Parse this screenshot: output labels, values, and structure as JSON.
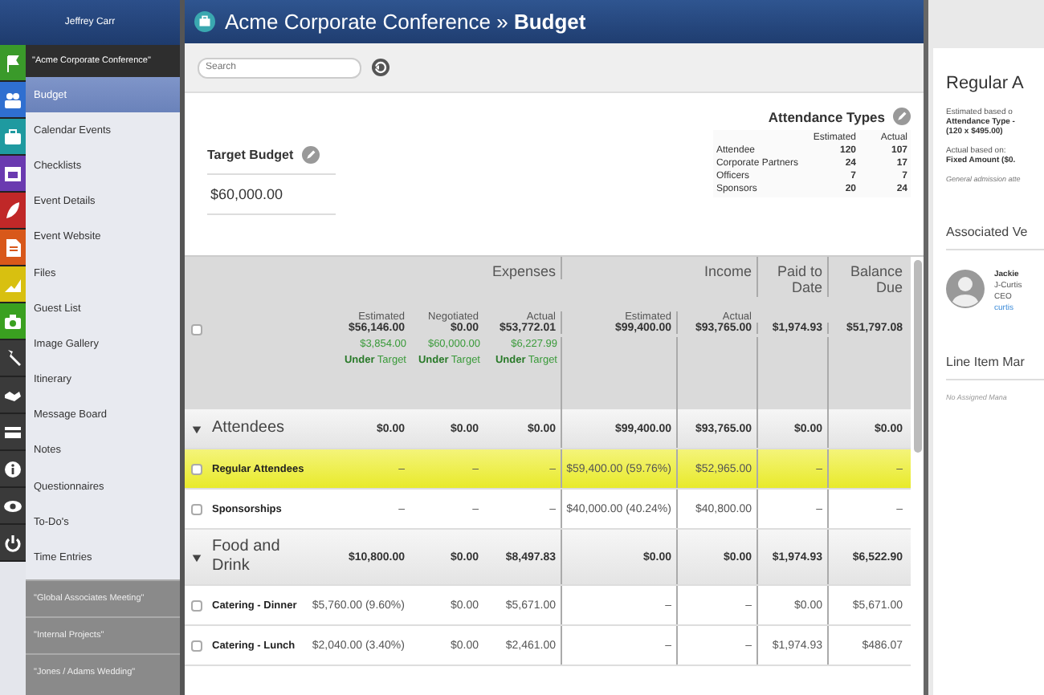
{
  "sidebar": {
    "user": "Jeffrey Carr",
    "icon_strip": [
      {
        "color": "#3a9a2a"
      },
      {
        "color": "#2f6fd0"
      },
      {
        "color": "#1f9aa0"
      },
      {
        "color": "#6a3ab0"
      },
      {
        "color": "#c02828"
      },
      {
        "color": "#d8581a"
      },
      {
        "color": "#d8c010"
      },
      {
        "color": "#3aa020"
      },
      {
        "color": "#3a3a3a"
      },
      {
        "color": "#3a3a3a"
      },
      {
        "color": "#3a3a3a"
      },
      {
        "color": "#3a3a3a"
      },
      {
        "color": "#3a3a3a"
      },
      {
        "color": "#3a3a3a"
      }
    ],
    "current_event": "\"Acme Corporate Conference\"",
    "items": [
      {
        "label": "Budget",
        "selected": true
      },
      {
        "label": "Calendar Events",
        "selected": false
      },
      {
        "label": "Checklists",
        "selected": false
      },
      {
        "label": "Event Details",
        "selected": false
      },
      {
        "label": "Event Website",
        "selected": false
      },
      {
        "label": "Files",
        "selected": false
      },
      {
        "label": "Guest List",
        "selected": false
      },
      {
        "label": "Image Gallery",
        "selected": false
      },
      {
        "label": "Itinerary",
        "selected": false
      },
      {
        "label": "Message Board",
        "selected": false
      },
      {
        "label": "Notes",
        "selected": false
      },
      {
        "label": "Questionnaires",
        "selected": false
      },
      {
        "label": "To-Do's",
        "selected": false
      },
      {
        "label": "Time Entries",
        "selected": false
      }
    ],
    "other_events": [
      "\"Global Associates Meeting\"",
      "\"Internal Projects\"",
      "\"Jones / Adams Wedding\""
    ]
  },
  "header": {
    "title": "Acme Corporate Conference » **Budget**"
  },
  "search": {
    "placeholder": "Search"
  },
  "target_budget": {
    "title": "Target Budget",
    "value": "$60,000.00"
  },
  "attendance_types": {
    "title": "Attendance Types",
    "columns": [
      "",
      "Estimated",
      "Actual"
    ],
    "rows": [
      [
        "Attendee",
        "120",
        "107"
      ],
      [
        "Corporate Partners",
        "24",
        "17"
      ],
      [
        "Officers",
        "7",
        "7"
      ],
      [
        "Sponsors",
        "20",
        "24"
      ]
    ]
  },
  "table": {
    "select_all_checked": false,
    "groups": [
      {
        "label": "Expenses"
      },
      {
        "label": "Income"
      },
      {
        "label": "Paid to Date"
      },
      {
        "label": "Balance Due"
      }
    ],
    "subheads": [
      "Estimated",
      "Negotiated",
      "Actual",
      "Estimated",
      "Actual"
    ],
    "totals": [
      "$56,146.00",
      "$0.00",
      "$53,772.01",
      "$99,400.00",
      "$93,765.00",
      "$1,974.93",
      "$51,797.08"
    ],
    "targets": [
      {
        "amount": "$3,854.00",
        "note": "**Under** Target"
      },
      {
        "amount": "$60,000.00",
        "note": "**Under** Target"
      },
      {
        "amount": "$6,227.99",
        "note": "**Under** Target"
      }
    ],
    "rows": [
      {
        "kind": "group",
        "name": "Attendees",
        "expanded": true,
        "cells": [
          "$0.00",
          "$0.00",
          "$0.00",
          "$99,400.00",
          "$93,765.00",
          "$0.00",
          "$0.00"
        ]
      },
      {
        "kind": "item",
        "name": "Regular Attendees",
        "selected": true,
        "checked": false,
        "cells": [
          "–",
          "–",
          "–",
          "$59,400.00 (59.76%)",
          "$52,965.00",
          "–",
          "–"
        ]
      },
      {
        "kind": "item",
        "name": "Sponsorships",
        "selected": false,
        "checked": false,
        "cells": [
          "–",
          "–",
          "–",
          "$40,000.00 (40.24%)",
          "$40,800.00",
          "–",
          "–"
        ]
      },
      {
        "kind": "group",
        "name": "Food and Drink",
        "expanded": true,
        "cells": [
          "$10,800.00",
          "$0.00",
          "$8,497.83",
          "$0.00",
          "$0.00",
          "$1,974.93",
          "$6,522.90"
        ]
      },
      {
        "kind": "item",
        "name": "Catering - Dinner",
        "selected": false,
        "checked": false,
        "cells": [
          "$5,760.00 (9.60%)",
          "$0.00",
          "$5,671.00",
          "–",
          "–",
          "$0.00",
          "$5,671.00"
        ]
      },
      {
        "kind": "item",
        "name": "Catering - Lunch",
        "selected": false,
        "checked": false,
        "cells": [
          "$2,040.00 (3.40%)",
          "$0.00",
          "$2,461.00",
          "–",
          "–",
          "$1,974.93",
          "$486.07"
        ]
      }
    ]
  },
  "detail": {
    "title": "Regular A",
    "estimated_label": "Estimated based o",
    "estimated_value": "Attendance Type -",
    "estimated_formula": "(120 x $495.00)",
    "actual_label": "Actual based on:",
    "actual_value": "Fixed Amount ($0.",
    "description": "General admission atte",
    "vendors_title": "Associated Ve",
    "vendor": {
      "name": "Jackie",
      "company": "J-Curtis",
      "role": "CEO",
      "link": "curtis"
    },
    "managers_title": "Line Item Mar",
    "managers_empty": "No Assigned Mana"
  }
}
